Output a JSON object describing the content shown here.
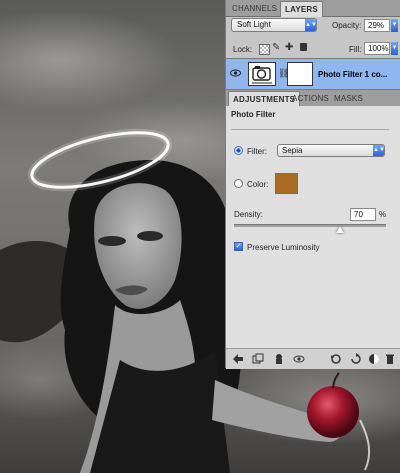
{
  "layers_panel": {
    "tabs": [
      {
        "label": "CHANNELS",
        "active": false
      },
      {
        "label": "LAYERS",
        "active": true
      }
    ],
    "blend_mode": "Soft Light",
    "opacity_label": "Opacity:",
    "opacity": "29%",
    "lock_label": "Lock:",
    "fill_label": "Fill:",
    "fill": "100%",
    "layer": {
      "name": "Photo Filter 1 co...",
      "visible": true,
      "selected": true
    }
  },
  "adjustments_panel": {
    "tabs": [
      {
        "label": "ADJUSTMENTS",
        "active": true
      },
      {
        "label": "ACTIONS",
        "active": false
      },
      {
        "label": "MASKS",
        "active": false
      }
    ],
    "title": "Photo Filter",
    "filter_label": "Filter:",
    "filter_value": "Sepia",
    "filter_selected": true,
    "color_label": "Color:",
    "color_swatch": "#a86a25",
    "density_label": "Density:",
    "density_value": "70",
    "density_unit": "%",
    "preserve_luminosity_label": "Preserve Luminosity",
    "preserve_luminosity_checked": true,
    "bottom_icons": [
      "back-arrow-icon",
      "new-view-icon",
      "clip-to-layer-icon",
      "eye-icon",
      "view-previous-icon",
      "reset-icon",
      "visibility-icon",
      "delete-icon"
    ]
  },
  "colors": {
    "selection_blue": "#8fb6ee",
    "accent_blue": "#2a63d4",
    "apple_red": "#b0182e"
  }
}
